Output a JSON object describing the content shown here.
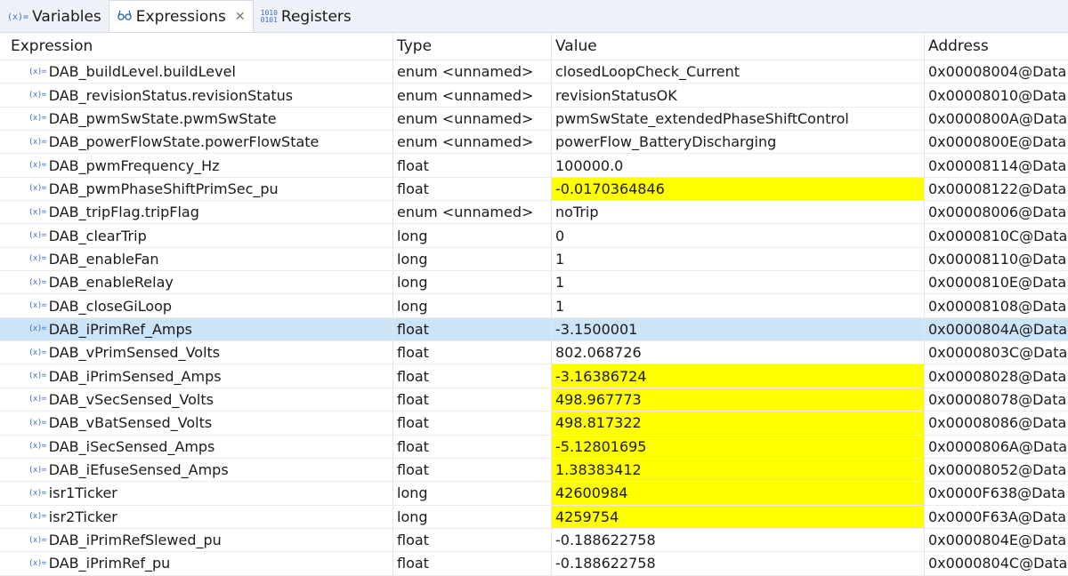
{
  "tabs": [
    {
      "label": "Variables",
      "icon_text": "(x)="
    },
    {
      "label": "Expressions",
      "icon_text": "6%"
    },
    {
      "label": "Registers",
      "icon_text": "1010\n0101"
    }
  ],
  "table": {
    "headers": [
      "Expression",
      "Type",
      "Value",
      "Address"
    ],
    "icon_text": "(x)=",
    "rows": [
      {
        "expression": "DAB_buildLevel.buildLevel",
        "type": "enum <unnamed>",
        "value": "closedLoopCheck_Current",
        "address": "0x00008004@Data"
      },
      {
        "expression": "DAB_revisionStatus.revisionStatus",
        "type": "enum <unnamed>",
        "value": "revisionStatusOK",
        "address": "0x00008010@Data"
      },
      {
        "expression": "DAB_pwmSwState.pwmSwState",
        "type": "enum <unnamed>",
        "value": "pwmSwState_extendedPhaseShiftControl",
        "address": "0x0000800A@Data"
      },
      {
        "expression": "DAB_powerFlowState.powerFlowState",
        "type": "enum <unnamed>",
        "value": "powerFlow_BatteryDischarging",
        "address": "0x0000800E@Data"
      },
      {
        "expression": "DAB_pwmFrequency_Hz",
        "type": "float",
        "value": "100000.0",
        "address": "0x00008114@Data"
      },
      {
        "expression": "DAB_pwmPhaseShiftPrimSec_pu",
        "type": "float",
        "value": "-0.0170364846",
        "address": "0x00008122@Data",
        "changed": true
      },
      {
        "expression": "DAB_tripFlag.tripFlag",
        "type": "enum <unnamed>",
        "value": "noTrip",
        "address": "0x00008006@Data"
      },
      {
        "expression": "DAB_clearTrip",
        "type": "long",
        "value": "0",
        "address": "0x0000810C@Data"
      },
      {
        "expression": "DAB_enableFan",
        "type": "long",
        "value": "1",
        "address": "0x00008110@Data"
      },
      {
        "expression": "DAB_enableRelay",
        "type": "long",
        "value": "1",
        "address": "0x0000810E@Data"
      },
      {
        "expression": "DAB_closeGiLoop",
        "type": "long",
        "value": "1",
        "address": "0x00008108@Data"
      },
      {
        "expression": "DAB_iPrimRef_Amps",
        "type": "float",
        "value": "-3.1500001",
        "address": "0x0000804A@Data",
        "selected": true
      },
      {
        "expression": "DAB_vPrimSensed_Volts",
        "type": "float",
        "value": "802.068726",
        "address": "0x0000803C@Data"
      },
      {
        "expression": "DAB_iPrimSensed_Amps",
        "type": "float",
        "value": "-3.16386724",
        "address": "0x00008028@Data",
        "changed": true
      },
      {
        "expression": "DAB_vSecSensed_Volts",
        "type": "float",
        "value": "498.967773",
        "address": "0x00008078@Data",
        "changed": true
      },
      {
        "expression": "DAB_vBatSensed_Volts",
        "type": "float",
        "value": "498.817322",
        "address": "0x00008086@Data",
        "changed": true
      },
      {
        "expression": "DAB_iSecSensed_Amps",
        "type": "float",
        "value": "-5.12801695",
        "address": "0x0000806A@Data",
        "changed": true
      },
      {
        "expression": "DAB_iEfuseSensed_Amps",
        "type": "float",
        "value": "1.38383412",
        "address": "0x00008052@Data",
        "changed": true
      },
      {
        "expression": "isr1Ticker",
        "type": "long",
        "value": "42600984",
        "address": "0x0000F638@Data",
        "changed": true
      },
      {
        "expression": "isr2Ticker",
        "type": "long",
        "value": "4259754",
        "address": "0x0000F63A@Data",
        "changed": true
      },
      {
        "expression": "DAB_iPrimRefSlewed_pu",
        "type": "float",
        "value": "-0.188622758",
        "address": "0x0000804E@Data"
      },
      {
        "expression": "DAB_iPrimRef_pu",
        "type": "float",
        "value": "-0.188622758",
        "address": "0x0000804C@Data"
      }
    ]
  },
  "colors": {
    "changed_highlight": "#ffff00",
    "selected_row": "#cce4f7",
    "icon": "#3a6fc0"
  }
}
